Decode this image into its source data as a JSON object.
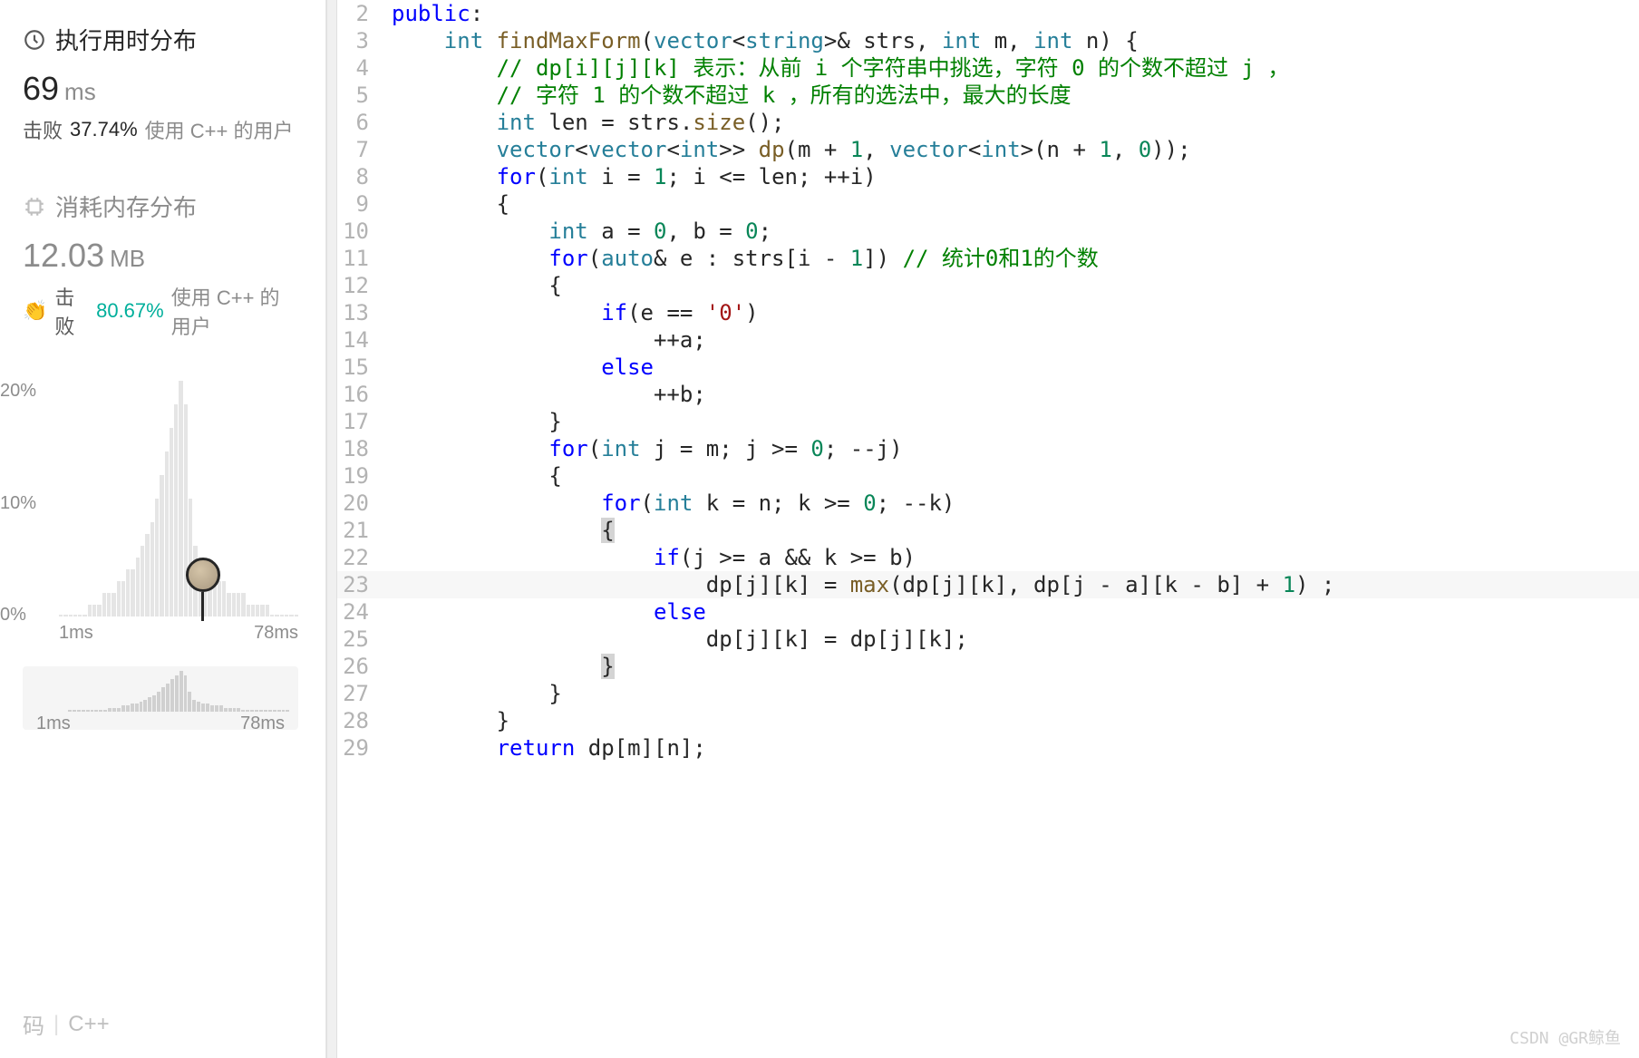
{
  "sidebar": {
    "runtime": {
      "title": "执行用时分布",
      "value": "69",
      "unit": "ms",
      "beat_label": "击败",
      "beat_pct": "37.74%",
      "beat_suffix": "使用 C++ 的用户"
    },
    "memory": {
      "title": "消耗内存分布",
      "value": "12.03",
      "unit": "MB",
      "beat_label": "击败",
      "beat_pct": "80.67%",
      "beat_suffix": "使用 C++ 的用户"
    },
    "chart": {
      "y_labels": [
        "20%",
        "10%",
        "0%"
      ],
      "x_labels": [
        "1ms",
        "78ms"
      ],
      "mini_x_labels": [
        "1ms",
        "78ms"
      ]
    },
    "bottom": {
      "code_label": "码",
      "lang": "C++"
    }
  },
  "code": {
    "lines": [
      {
        "n": "2",
        "indent": 0,
        "html": "<span class='kw'>public</span>:"
      },
      {
        "n": "3",
        "indent": 1,
        "html": "<span class='type'>int</span> <span class='func'>findMaxForm</span>(<span class='type'>vector</span>&lt;<span class='type'>string</span>&gt;&amp; strs, <span class='type'>int</span> m, <span class='type'>int</span> n) {"
      },
      {
        "n": "4",
        "indent": 2,
        "html": "<span class='comment'>// dp[i][j][k] 表示：从前 i 个字符串中挑选，字符 0 的个数不超过 j ，</span>"
      },
      {
        "n": "5",
        "indent": 2,
        "html": "<span class='comment'>// 字符 1 的个数不超过 k ，所有的选法中，最大的长度</span>"
      },
      {
        "n": "6",
        "indent": 2,
        "html": "<span class='type'>int</span> len = strs.<span class='func'>size</span>();"
      },
      {
        "n": "7",
        "indent": 2,
        "html": "<span class='type'>vector</span>&lt;<span class='type'>vector</span>&lt;<span class='type'>int</span>&gt;&gt; <span class='func'>dp</span>(m + <span class='num'>1</span>, <span class='type'>vector</span>&lt;<span class='type'>int</span>&gt;(n + <span class='num'>1</span>, <span class='num'>0</span>));"
      },
      {
        "n": "8",
        "indent": 2,
        "html": "<span class='kw'>for</span>(<span class='type'>int</span> i = <span class='num'>1</span>; i &lt;= len; ++i)"
      },
      {
        "n": "9",
        "indent": 2,
        "html": "{"
      },
      {
        "n": "10",
        "indent": 3,
        "html": "<span class='type'>int</span> a = <span class='num'>0</span>, b = <span class='num'>0</span>;"
      },
      {
        "n": "11",
        "indent": 3,
        "html": "<span class='kw'>for</span>(<span class='type'>auto</span>&amp; e : strs[i - <span class='num'>1</span>]) <span class='comment'>// 统计0和1的个数</span>"
      },
      {
        "n": "12",
        "indent": 3,
        "html": "{"
      },
      {
        "n": "13",
        "indent": 4,
        "html": "<span class='kw'>if</span>(e == <span class='str'>'0'</span>)"
      },
      {
        "n": "14",
        "indent": 5,
        "html": "++a;"
      },
      {
        "n": "15",
        "indent": 4,
        "html": "<span class='kw'>else</span>"
      },
      {
        "n": "16",
        "indent": 5,
        "html": "++b;"
      },
      {
        "n": "17",
        "indent": 3,
        "html": "}"
      },
      {
        "n": "18",
        "indent": 3,
        "html": "<span class='kw'>for</span>(<span class='type'>int</span> j = m; j &gt;= <span class='num'>0</span>; --j)"
      },
      {
        "n": "19",
        "indent": 3,
        "html": "{"
      },
      {
        "n": "20",
        "indent": 4,
        "html": "<span class='kw'>for</span>(<span class='type'>int</span> k = n; k &gt;= <span class='num'>0</span>; --k)"
      },
      {
        "n": "21",
        "indent": 4,
        "html": "<span class='brace-hl'>{</span>"
      },
      {
        "n": "22",
        "indent": 5,
        "html": "<span class='kw'>if</span>(j &gt;= a &amp;&amp; k &gt;= b)"
      },
      {
        "n": "23",
        "indent": 6,
        "html": "dp[j][k] = <span class='func'>max</span>(dp[j][k], dp[j - a][k - b] + <span class='num'>1</span>) ;",
        "hl": true
      },
      {
        "n": "24",
        "indent": 5,
        "html": "<span class='kw'>else</span>"
      },
      {
        "n": "25",
        "indent": 6,
        "html": "dp[j][k] = dp[j][k];"
      },
      {
        "n": "26",
        "indent": 4,
        "html": "<span class='brace-hl'>}</span>"
      },
      {
        "n": "27",
        "indent": 3,
        "html": "}"
      },
      {
        "n": "28",
        "indent": 2,
        "html": "}"
      },
      {
        "n": "29",
        "indent": 2,
        "html": "<span class='kw'>return</span> dp[m][n];"
      }
    ]
  },
  "chart_data": {
    "type": "bar",
    "title": "执行用时分布",
    "xlabel": "ms",
    "ylabel": "%",
    "ylim": [
      0,
      20
    ],
    "x_range": [
      "1ms",
      "78ms"
    ],
    "approx_distribution": [
      0,
      0,
      0,
      0,
      0,
      0,
      1,
      1,
      1,
      2,
      2,
      2,
      3,
      3,
      4,
      4,
      5,
      6,
      7,
      8,
      10,
      12,
      14,
      16,
      18,
      20,
      18,
      10,
      6,
      5,
      4,
      4,
      3,
      3,
      3,
      2,
      2,
      2,
      2,
      1,
      1,
      1,
      1,
      1,
      0,
      0,
      0,
      0,
      0,
      0
    ],
    "user_marker_position_pct": 56
  },
  "watermark": "CSDN @GR鲸鱼"
}
